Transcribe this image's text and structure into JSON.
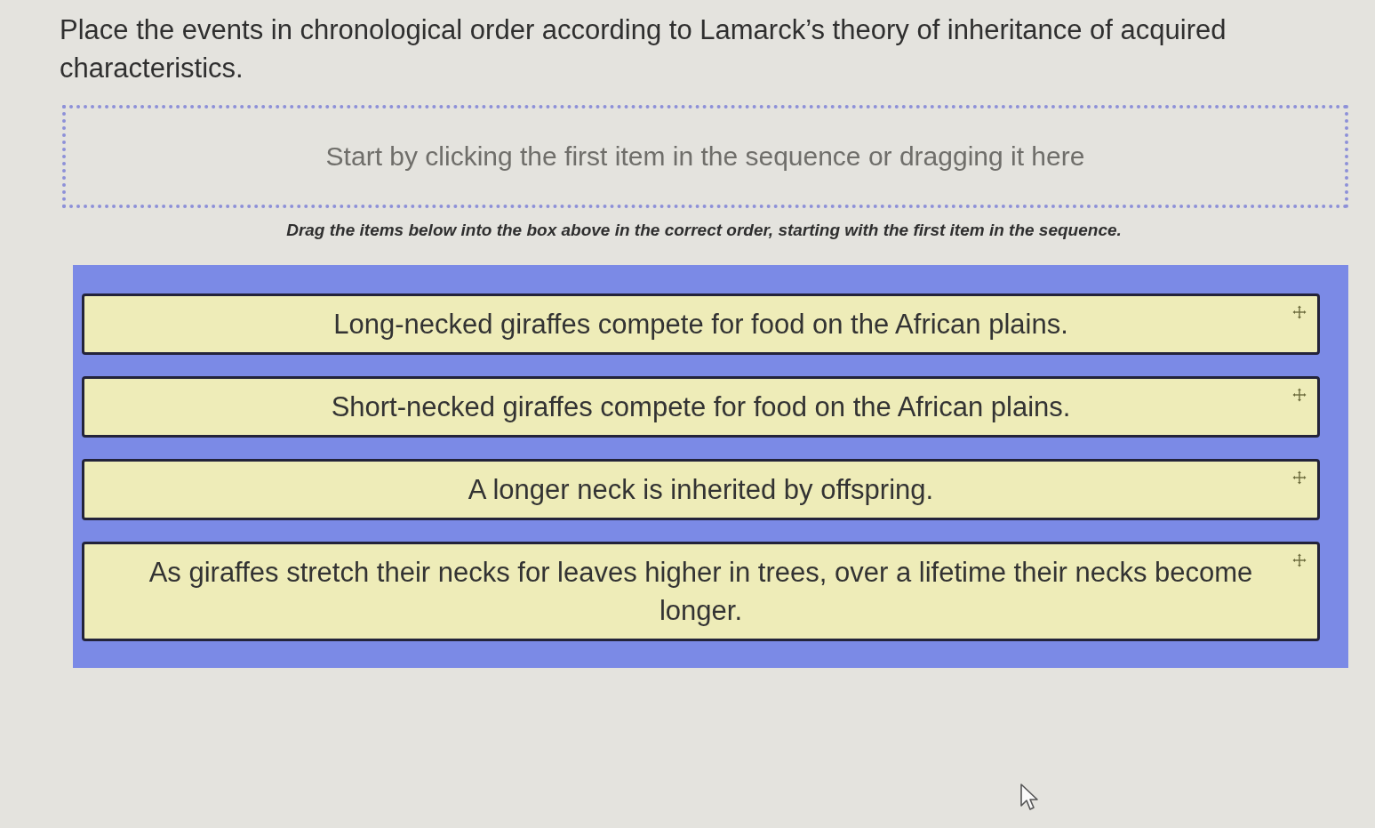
{
  "question": {
    "prompt": "Place the events in chronological order according to Lamarck’s theory of inheritance of acquired characteristics."
  },
  "answer_box": {
    "placeholder": "Start by clicking the first item in the sequence or dragging it here"
  },
  "instruction": "Drag the items below into the box above in the correct order, starting with the first item in the sequence.",
  "items": [
    {
      "text": "Long-necked giraffes compete for food on the African plains."
    },
    {
      "text": "Short-necked giraffes compete for food on the African plains."
    },
    {
      "text": "A longer neck is inherited by offspring."
    },
    {
      "text": "As giraffes stretch their necks for leaves higher in trees, over a lifetime their necks become longer."
    }
  ]
}
